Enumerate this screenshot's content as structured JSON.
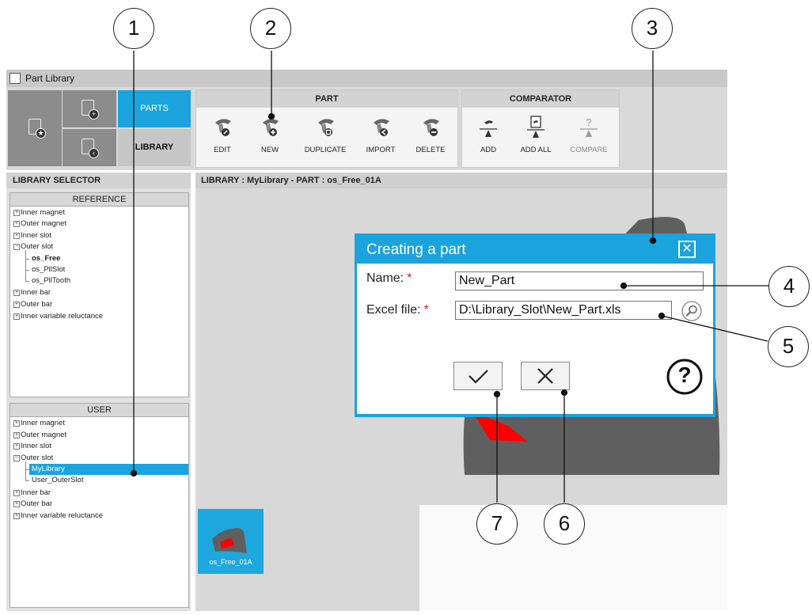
{
  "window": {
    "title": "Part Library"
  },
  "ribbon": {
    "tabs": {
      "parts": "PARTS",
      "library": "LIBRARY"
    },
    "part_group": {
      "title": "PART",
      "buttons": [
        {
          "label": "EDIT",
          "icon": "edit-part-icon"
        },
        {
          "label": "NEW",
          "icon": "new-part-icon"
        },
        {
          "label": "DUPLICATE",
          "icon": "duplicate-part-icon"
        },
        {
          "label": "IMPORT",
          "icon": "import-part-icon"
        },
        {
          "label": "DELETE",
          "icon": "delete-part-icon"
        }
      ]
    },
    "comparator_group": {
      "title": "COMPARATOR",
      "buttons": [
        {
          "label": "ADD",
          "icon": "comparator-add-icon"
        },
        {
          "label": "ADD ALL",
          "icon": "comparator-add-all-icon"
        },
        {
          "label": "COMPARE",
          "icon": "compare-icon",
          "disabled": true
        }
      ]
    }
  },
  "library_selector": {
    "header": "LIBRARY SELECTOR",
    "reference": {
      "title": "REFERENCE",
      "items": [
        "Inner magnet",
        "Outer magnet",
        "Inner slot",
        "Outer slot",
        "os_Free",
        "os_PllSlot",
        "os_PllTooth",
        "Inner bar",
        "Outer bar",
        "Inner variable reluctance"
      ]
    },
    "user": {
      "title": "USER",
      "items": [
        "Inner magnet",
        "Outer magnet",
        "Inner slot",
        "Outer slot",
        "MyLibrary",
        "User_OuterSlot",
        "Inner bar",
        "Outer bar",
        "Inner variable reluctance"
      ]
    }
  },
  "main": {
    "header": "LIBRARY : MyLibrary   -   PART : os_Free_01A",
    "thumbnail_label": "os_Free_01A"
  },
  "dialog": {
    "title": "Creating a part",
    "name_label": "Name:",
    "name_value": "New_Part",
    "excel_label": "Excel file:",
    "excel_value": "D:\\Library_Slot\\New_Part.xls",
    "required_mark": "*",
    "help": "?"
  },
  "callouts": [
    "1",
    "2",
    "3",
    "4",
    "5",
    "6",
    "7"
  ],
  "colors": {
    "accent": "#1aa3dd",
    "tile": "#8c8c8c",
    "required": "#c0202a",
    "part_red": "#ff0000"
  }
}
